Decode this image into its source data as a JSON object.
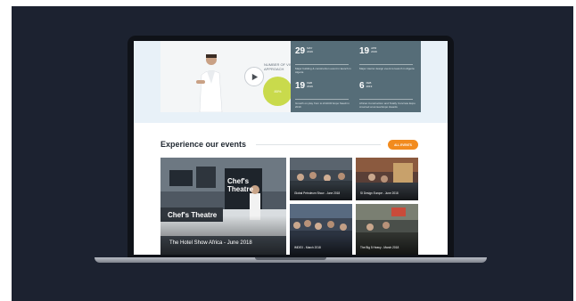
{
  "hero": {
    "visitor_label": "NUMBER OF VISITORS TO APPROACH",
    "visitor_value": "80%",
    "dates": [
      {
        "day": "29",
        "month": "MAY\n2019",
        "desc": "Major building & construction event in launch in Algeria"
      },
      {
        "day": "19",
        "month": "APR\n2019",
        "desc": "Major interior design event to launch in Algeria"
      },
      {
        "day": "19",
        "month": "FEB\n2019",
        "desc": "Growth on play from to HVACR Expo Saudi in 2019"
      },
      {
        "day": "6",
        "month": "FEB\n2019",
        "desc": "African Construction and Totally Concrete Expo crowned at annual Expo Awards"
      }
    ]
  },
  "events": {
    "title": "Experience our events",
    "all_button": "ALL EVENTS",
    "tiles": [
      {
        "caption": "The Hotel Show Africa - June 2018",
        "sign": "Chef's Theatre"
      },
      {
        "caption": "Global Petroleum Show - June 2018"
      },
      {
        "caption": "SI Design Europe - June 2018"
      },
      {
        "caption": "IMDEX - March 2018"
      },
      {
        "caption": "The Big 5 Heavy - March 2018"
      }
    ]
  },
  "colors": {
    "background": "#1c2230",
    "accent": "#f28b1e",
    "bubble": "#c9da4c",
    "dates_panel": "#566d78"
  }
}
